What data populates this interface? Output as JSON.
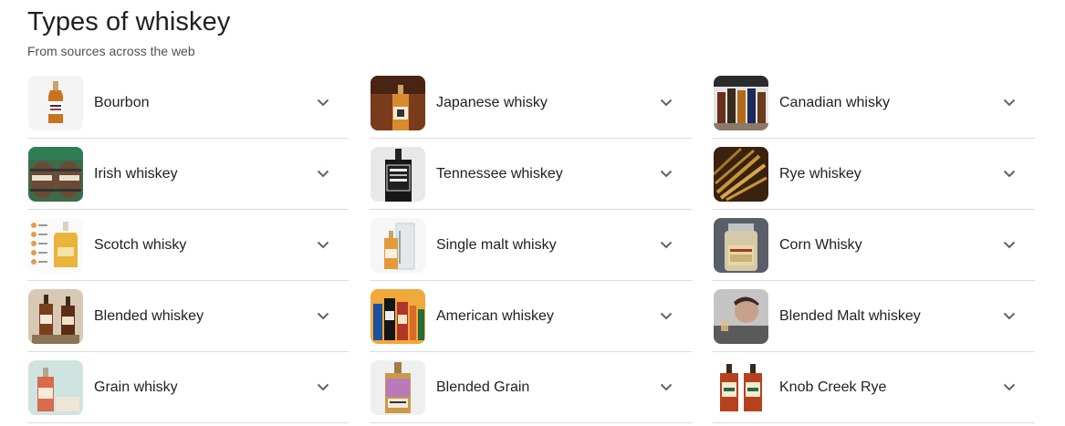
{
  "header": {
    "title": "Types of whiskey",
    "subtitle": "From sources across the web"
  },
  "columns": [
    {
      "items": [
        {
          "label": "Bourbon",
          "icon": "bourbon-bottle-image"
        },
        {
          "label": "Irish whiskey",
          "icon": "barrels-image"
        },
        {
          "label": "Scotch whisky",
          "icon": "scotch-infographic-image"
        },
        {
          "label": "Blended whiskey",
          "icon": "blended-bottles-image"
        },
        {
          "label": "Grain whisky",
          "icon": "grain-bottle-image"
        }
      ]
    },
    {
      "items": [
        {
          "label": "Japanese whisky",
          "icon": "japanese-bottle-image"
        },
        {
          "label": "Tennessee whiskey",
          "icon": "tennessee-bottle-image"
        },
        {
          "label": "Single malt whisky",
          "icon": "single-malt-box-image"
        },
        {
          "label": "American whiskey",
          "icon": "american-bottles-image"
        },
        {
          "label": "Blended Grain",
          "icon": "blended-grain-bottle-image"
        }
      ]
    },
    {
      "items": [
        {
          "label": "Canadian whisky",
          "icon": "canadian-bottles-image"
        },
        {
          "label": "Rye whiskey",
          "icon": "rye-grain-image"
        },
        {
          "label": "Corn Whisky",
          "icon": "corn-jar-image"
        },
        {
          "label": "Blended Malt whiskey",
          "icon": "man-with-glass-image"
        },
        {
          "label": "Knob Creek Rye",
          "icon": "knob-creek-bottles-image"
        }
      ]
    }
  ],
  "colors": {
    "text": "#202124",
    "subtext": "#4d5156",
    "divider": "#dadce0",
    "chevron": "#5f6368"
  }
}
